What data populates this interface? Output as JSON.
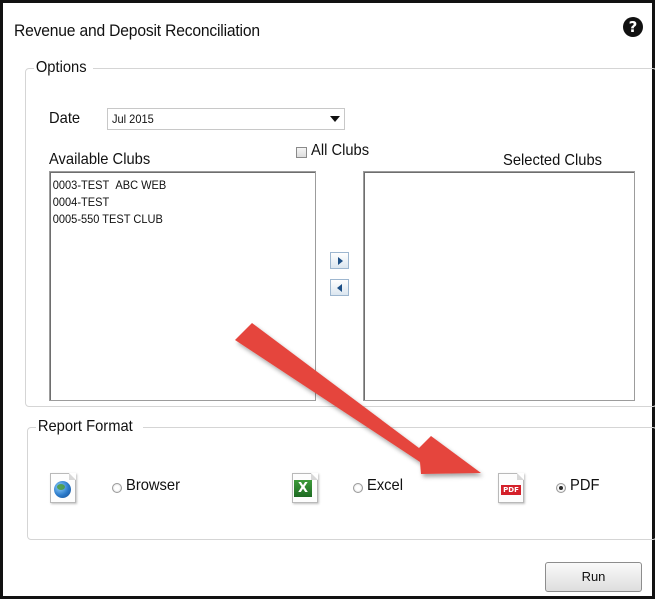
{
  "dialog": {
    "title": "Revenue and Deposit Reconciliation",
    "help_icon": "help-icon"
  },
  "options": {
    "legend": "Options",
    "date_label": "Date",
    "date_value": "Jul 2015",
    "available_label": "Available Clubs",
    "all_clubs_label": "All Clubs",
    "all_clubs_checked": false,
    "selected_label": "Selected Clubs",
    "available_items": [
      "0003-TEST  ABC WEB",
      "0004-TEST",
      "0005-550 TEST CLUB"
    ],
    "selected_items": [],
    "move_right_icon": "arrow-right-icon",
    "move_left_icon": "arrow-left-icon"
  },
  "report_format": {
    "legend": "Report Format",
    "options": [
      {
        "label": "Browser",
        "icon": "globe-document-icon",
        "checked": false
      },
      {
        "label": "Excel",
        "icon": "excel-document-icon",
        "checked": false
      },
      {
        "label": "PDF",
        "icon": "pdf-document-icon",
        "checked": true
      }
    ],
    "excel_badge": "X",
    "pdf_badge": "PDF"
  },
  "actions": {
    "run_label": "Run"
  },
  "annotation": {
    "icon": "red-arrow-icon",
    "color": "#e5453d"
  }
}
